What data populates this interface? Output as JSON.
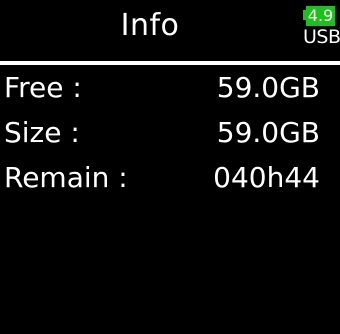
{
  "header": {
    "title": "Info",
    "battery_level": "4.9",
    "power_source": "USB",
    "battery_color": "#18c418"
  },
  "rows": [
    {
      "label": "Free :",
      "value": "59.0GB"
    },
    {
      "label": "Size :",
      "value": "59.0GB"
    },
    {
      "label": "Remain :",
      "value": "040h44"
    }
  ]
}
